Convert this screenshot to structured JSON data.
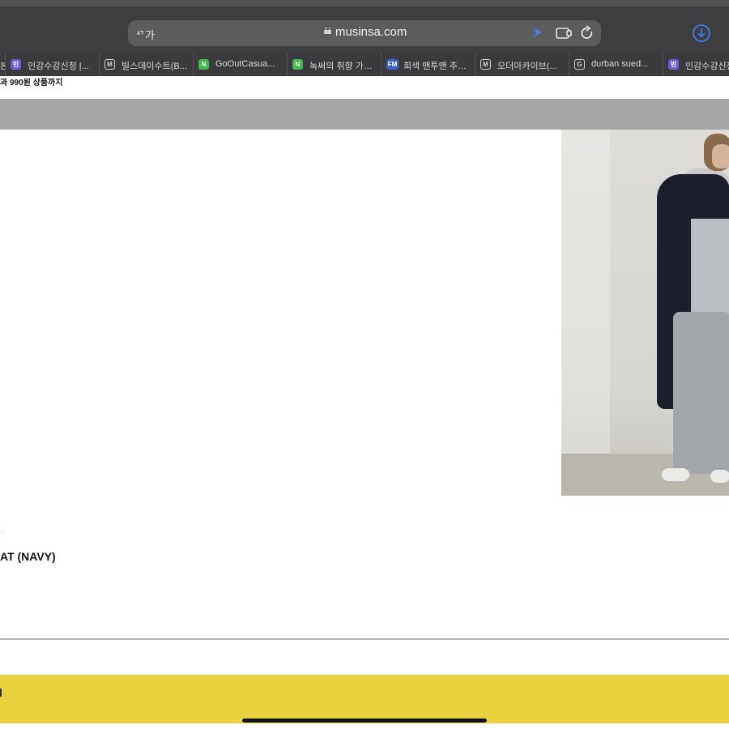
{
  "browser": {
    "text_size_button": "ᄭ가",
    "url": "musinsa.com",
    "bookmarks": [
      {
        "icon": "purple-badge-icon",
        "label": "인강수강신청 |...",
        "favicon_text": "빈"
      },
      {
        "icon": "m-icon",
        "label": "빌스데이수트(B...",
        "favicon_text": "M"
      },
      {
        "icon": "naver-icon",
        "label": "GoOutCasua...",
        "favicon_text": "N"
      },
      {
        "icon": "naver-icon",
        "label": "녹써의 취향 가…",
        "favicon_text": "N"
      },
      {
        "icon": "fm-icon",
        "label": "회색 맨투맨 추…",
        "favicon_text": "FM"
      },
      {
        "icon": "m-icon",
        "label": "오더아카이브(...",
        "favicon_text": "M"
      },
      {
        "icon": "g-icon",
        "label": "durban sued...",
        "favicon_text": "G"
      },
      {
        "icon": "purple-badge-icon",
        "label": "인강수강신청",
        "favicon_text": "빈"
      }
    ],
    "first_bookmark_fragment": "본"
  },
  "page": {
    "promo_text": "과 990원 상품까지",
    "product_title": "AT (NAVY)"
  },
  "colors": {
    "toolbar": "#3e3e40",
    "graybar": "#a6a6a6",
    "yellow_banner": "#e8d23e"
  }
}
